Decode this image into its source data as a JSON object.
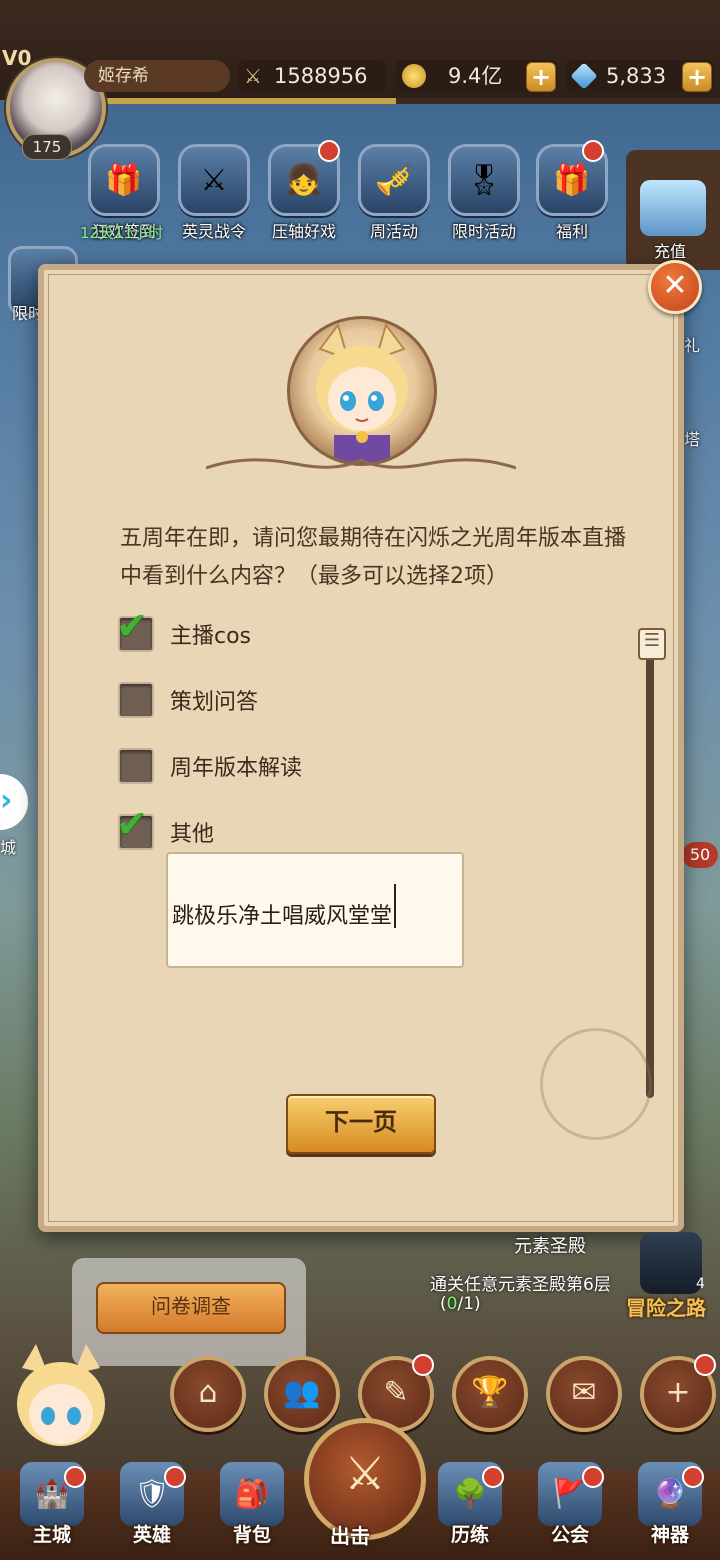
{
  "player": {
    "vip": "V0",
    "level": "175",
    "name": "姬存希"
  },
  "resources": {
    "power": "1588956",
    "gold": "9.4亿",
    "gems": "5,833",
    "plus": "+"
  },
  "events": [
    {
      "label": "狂欢签到",
      "icon": "🎁"
    },
    {
      "label": "英灵战令",
      "icon": "⚔"
    },
    {
      "label": "压轴好戏",
      "icon": "👧"
    },
    {
      "label": "周活动",
      "icon": "🎺"
    },
    {
      "label": "限时活动",
      "icon": "🎖"
    },
    {
      "label": "福利",
      "icon": "🎁"
    }
  ],
  "event_timer": "12天11小时",
  "side_labels": {
    "limited": "限时",
    "recharge": "充值",
    "gift": "礼",
    "tower": "塔",
    "city": "城",
    "badge": "50"
  },
  "dialog": {
    "close": "✕",
    "question": "五周年在即，请问您最期待在闪烁之光周年版本直播中看到什么内容？（最多可以选择2项）",
    "options": [
      {
        "label": "主播cos",
        "checked": true
      },
      {
        "label": "策划问答",
        "checked": false
      },
      {
        "label": "周年版本解读",
        "checked": false
      },
      {
        "label": "其他",
        "checked": true
      }
    ],
    "other_input": "跳极乐净土唱威风堂堂",
    "scroll_icon": "☰",
    "next_button": "下一页"
  },
  "survey_button": "问卷调查",
  "quest": {
    "title": "元素圣殿",
    "desc": "通关任意元素圣殿第6层",
    "progress_open": "(",
    "progress_done": "0",
    "progress_rest": "/1)",
    "road": "冒险之路",
    "count": "4"
  },
  "quick_buttons": [
    {
      "name": "home-quick-button",
      "icon": "⌂"
    },
    {
      "name": "friends-quick-button",
      "icon": "👥"
    },
    {
      "name": "tasks-quick-button",
      "icon": "✎"
    },
    {
      "name": "trophy-quick-button",
      "icon": "🏆"
    },
    {
      "name": "mail-quick-button",
      "icon": "✉"
    },
    {
      "name": "more-quick-button",
      "icon": "+"
    }
  ],
  "nav": [
    {
      "label": "主城",
      "icon": "🏰"
    },
    {
      "label": "英雄",
      "icon": "🛡"
    },
    {
      "label": "背包",
      "icon": "🎒"
    },
    {
      "label": "出击",
      "icon": "⚔"
    },
    {
      "label": "历练",
      "icon": "🌳"
    },
    {
      "label": "公会",
      "icon": "🚩"
    },
    {
      "label": "神器",
      "icon": "🔮"
    }
  ],
  "colors": {
    "accent": "#d78b22",
    "check": "#3fb334",
    "panel": "#e8d6b7"
  }
}
